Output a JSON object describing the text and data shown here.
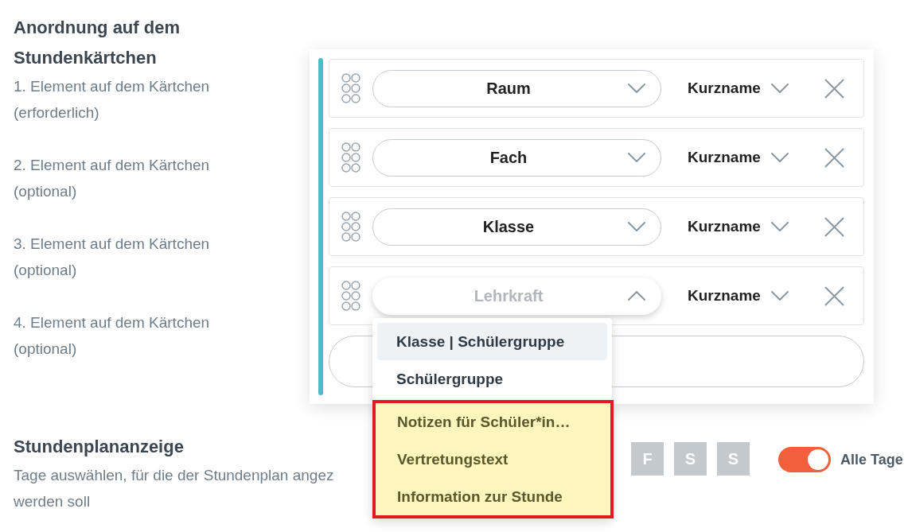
{
  "arrangement": {
    "title": "Anordnung auf dem Stundenkärtchen",
    "element_labels": [
      "1. Element auf dem Kärtchen (erforderlich)",
      "2. Element auf dem Kärtchen (optional)",
      "3. Element auf dem Kärtchen (optional)",
      "4. Element auf dem Kärtchen (optional)"
    ]
  },
  "card_elements": [
    {
      "field": "Raum",
      "format": "Kurzname",
      "open": false
    },
    {
      "field": "Fach",
      "format": "Kurzname",
      "open": false
    },
    {
      "field": "Klasse",
      "format": "Kurzname",
      "open": false
    },
    {
      "field": "Lehrkraft",
      "format": "Kurzname",
      "open": true,
      "dropdown": {
        "options": [
          {
            "label": "Klasse | Schülergruppe",
            "hovered": true,
            "annotated": false
          },
          {
            "label": "Schülergruppe",
            "hovered": false,
            "annotated": false
          },
          {
            "label": "Notizen für Schüler*in…",
            "hovered": false,
            "annotated": true
          },
          {
            "label": "Vertretungstext",
            "hovered": false,
            "annotated": true
          },
          {
            "label": "Information zur Stunde",
            "hovered": false,
            "annotated": true
          }
        ]
      }
    }
  ],
  "timetable_display": {
    "title": "Stundenplananzeige",
    "description_lines": [
      "Tage auswählen, für die der Stundenplan angez",
      "werden soll"
    ],
    "days": [
      {
        "label": "F",
        "selected": false
      },
      {
        "label": "S",
        "selected": false
      },
      {
        "label": "S",
        "selected": false
      }
    ],
    "all_days": {
      "label": "Alle Tage",
      "on": true
    }
  }
}
